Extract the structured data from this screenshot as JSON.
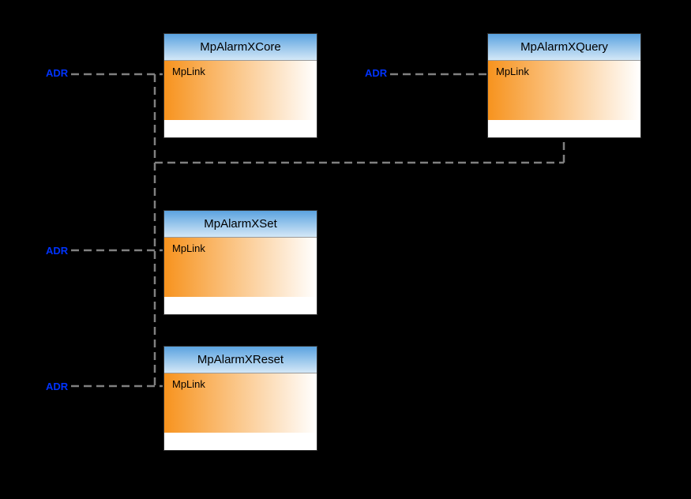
{
  "labels": {
    "adr1": "ADR",
    "adr2": "ADR",
    "adr3": "ADR",
    "adr4": "ADR"
  },
  "blocks": {
    "core": {
      "title": "MpAlarmXCore",
      "param": "MpLink"
    },
    "query": {
      "title": "MpAlarmXQuery",
      "param": "MpLink"
    },
    "set": {
      "title": "MpAlarmXSet",
      "param": "MpLink"
    },
    "reset": {
      "title": "MpAlarmXReset",
      "param": "MpLink"
    }
  }
}
